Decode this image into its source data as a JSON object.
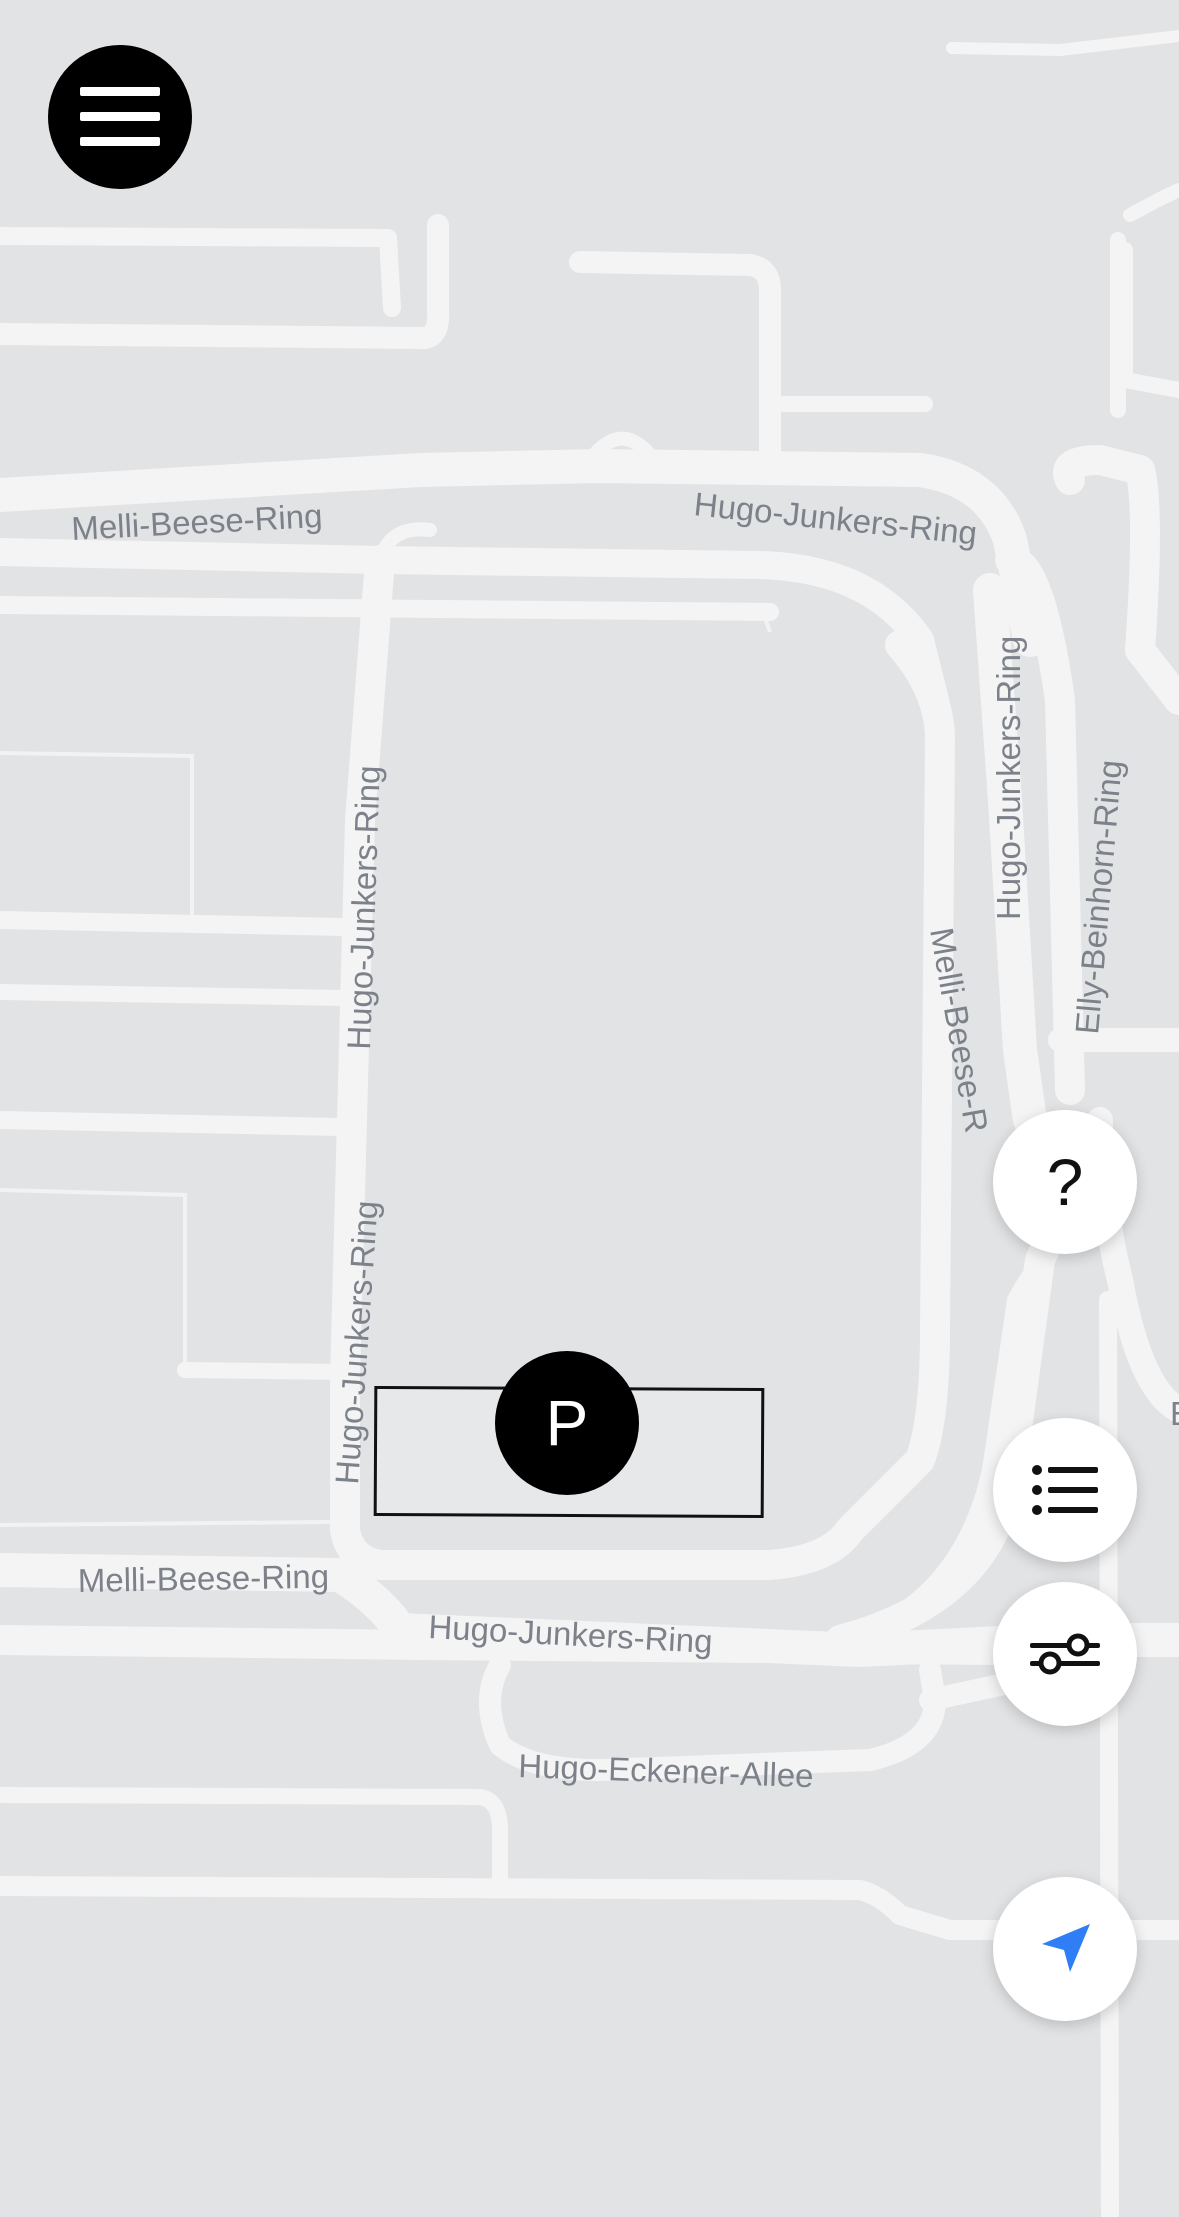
{
  "map": {
    "street_labels": {
      "melli_beese_ring_top": "Melli-Beese-Ring",
      "hugo_junkers_ring_top": "Hugo-Junkers-Ring",
      "hugo_junkers_ring_right": "Hugo-Junkers-Ring",
      "elly_beinhorn_ring": "Elly-Beinhorn-Ring",
      "hugo_junkers_ring_left_upper": "Hugo-Junkers-Ring",
      "hugo_junkers_ring_left_lower": "Hugo-Junkers-Ring",
      "melli_beese_ring_right": "Melli-Beese-R",
      "melli_beese_ring_bottom": "Melli-Beese-Ring",
      "hugo_junkers_ring_bottom": "Hugo-Junkers-Ring",
      "hugo_eckener_allee": "Hugo-Eckener-Allee",
      "edge_letter": "E"
    },
    "parking_marker": {
      "label": "P"
    }
  },
  "controls": {
    "menu_icon": "hamburger-menu-icon",
    "help_label": "?",
    "list_icon": "list-icon",
    "filter_icon": "sliders-icon",
    "locate_icon": "navigation-arrow-icon"
  },
  "colors": {
    "map_background": "#e2e3e5",
    "road": "#f4f4f5",
    "label": "#7d818a",
    "accent_locate": "#2f7ef5"
  }
}
